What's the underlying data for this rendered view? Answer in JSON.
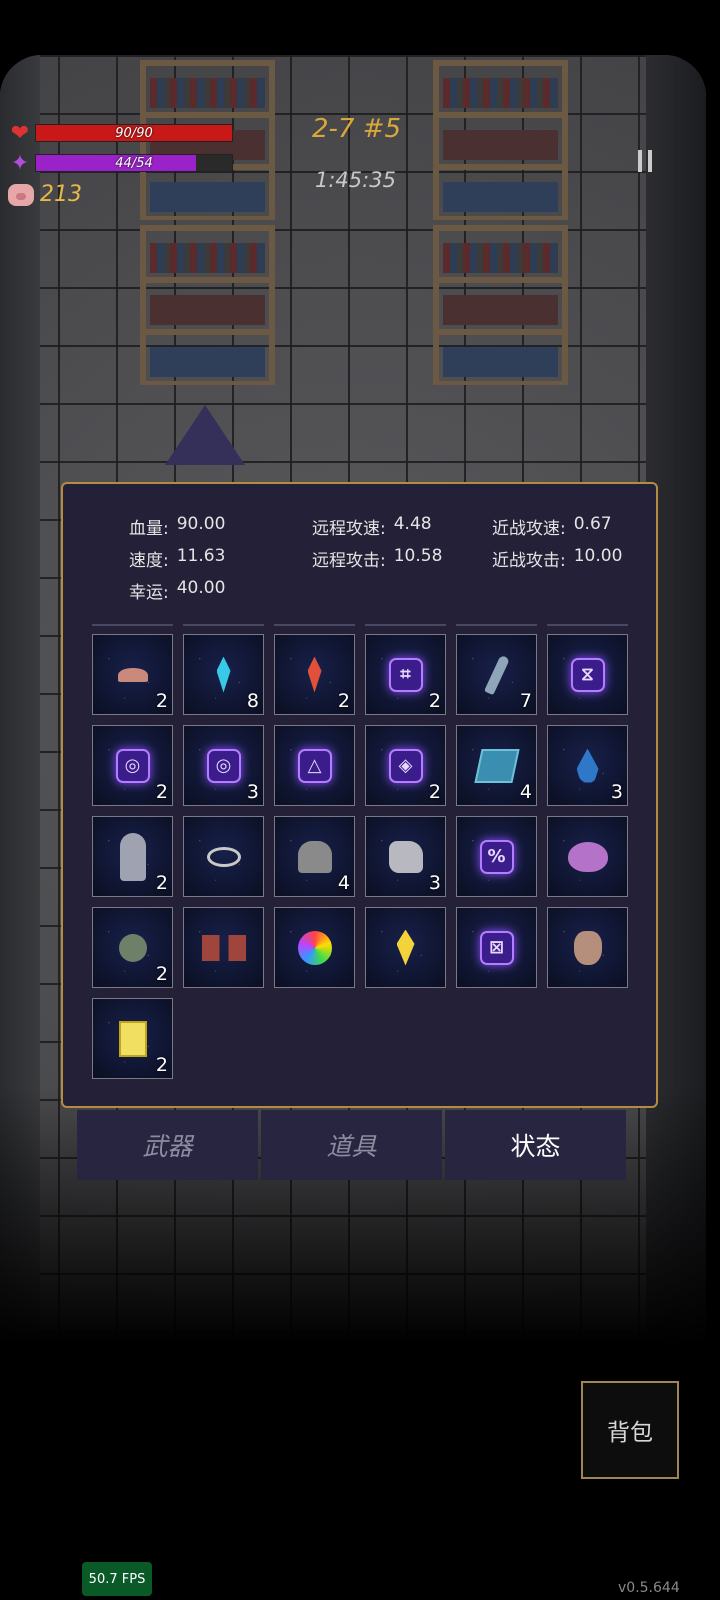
{
  "hud": {
    "hp_text": "90/90",
    "hp_fraction": 1.0,
    "mana_text": "44/54",
    "mana_fraction": 0.815,
    "coins": "213",
    "level": "2-7 #5",
    "timer": "1:45:35"
  },
  "stats": [
    [
      {
        "label": "血量:",
        "value": "90.00"
      },
      {
        "label": "远程攻速:",
        "value": "4.48"
      },
      {
        "label": "近战攻速:",
        "value": "0.67"
      }
    ],
    [
      {
        "label": "速度:",
        "value": "11.63"
      },
      {
        "label": "远程攻击:",
        "value": "10.58"
      },
      {
        "label": "近战攻击:",
        "value": "10.00"
      }
    ],
    [
      {
        "label": "幸运:",
        "value": "40.00"
      }
    ]
  ],
  "items": [
    {
      "icon": "mushroom-icon",
      "count": "2"
    },
    {
      "icon": "blue-crystal-icon",
      "count": "8"
    },
    {
      "icon": "red-crystal-icon",
      "count": "2"
    },
    {
      "icon": "rune-icon",
      "count": "2"
    },
    {
      "icon": "wand-icon",
      "count": "7"
    },
    {
      "icon": "rune-icon",
      "count": ""
    },
    {
      "icon": "rune-icon",
      "count": "2"
    },
    {
      "icon": "rune-icon",
      "count": "3"
    },
    {
      "icon": "rune-icon",
      "count": ""
    },
    {
      "icon": "rune-icon",
      "count": "2"
    },
    {
      "icon": "spellbook-icon",
      "count": "4"
    },
    {
      "icon": "water-drop-icon",
      "count": "3"
    },
    {
      "icon": "ghost-cloak-icon",
      "count": "2"
    },
    {
      "icon": "ring-icon",
      "count": ""
    },
    {
      "icon": "tombstone-icon",
      "count": "4"
    },
    {
      "icon": "stone-icon",
      "count": "3"
    },
    {
      "icon": "rune-icon",
      "count": ""
    },
    {
      "icon": "slime-icon",
      "count": ""
    },
    {
      "icon": "tentacle-creature-icon",
      "count": "2"
    },
    {
      "icon": "gloves-icon",
      "count": ""
    },
    {
      "icon": "rainbow-orb-icon",
      "count": ""
    },
    {
      "icon": "yellow-crystal-icon",
      "count": ""
    },
    {
      "icon": "rune-icon",
      "count": ""
    },
    {
      "icon": "pouch-icon",
      "count": ""
    },
    {
      "icon": "yellow-card-icon",
      "count": "2"
    }
  ],
  "tabs": [
    {
      "label": "武器",
      "active": false
    },
    {
      "label": "道具",
      "active": false
    },
    {
      "label": "状态",
      "active": true
    }
  ],
  "backpack_label": "背包",
  "fps": "50.7 FPS",
  "version": "v0.5.644"
}
